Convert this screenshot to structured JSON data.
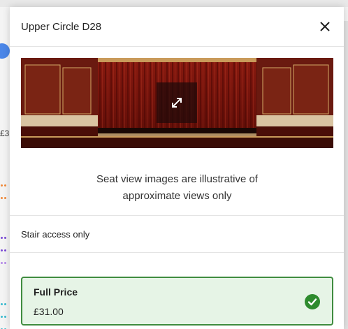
{
  "modal": {
    "title": "Upper Circle D28",
    "close_icon": "close-icon",
    "seat_view": {
      "expand_icon": "expand-icon",
      "disclaimer_line1": "Seat view images are illustrative of",
      "disclaimer_line2": "approximate views only"
    },
    "access_note": "Stair access only",
    "price_option": {
      "name": "Full Price",
      "amount": "£31.00",
      "selected_icon": "check-circle-icon",
      "selected": true
    }
  },
  "background": {
    "price_fragment": "£3"
  },
  "colors": {
    "selected_border": "#3f8c3f",
    "selected_fill": "#e6f4e6",
    "check_green": "#2e8b2e",
    "accent_blue": "#4a86e8"
  }
}
